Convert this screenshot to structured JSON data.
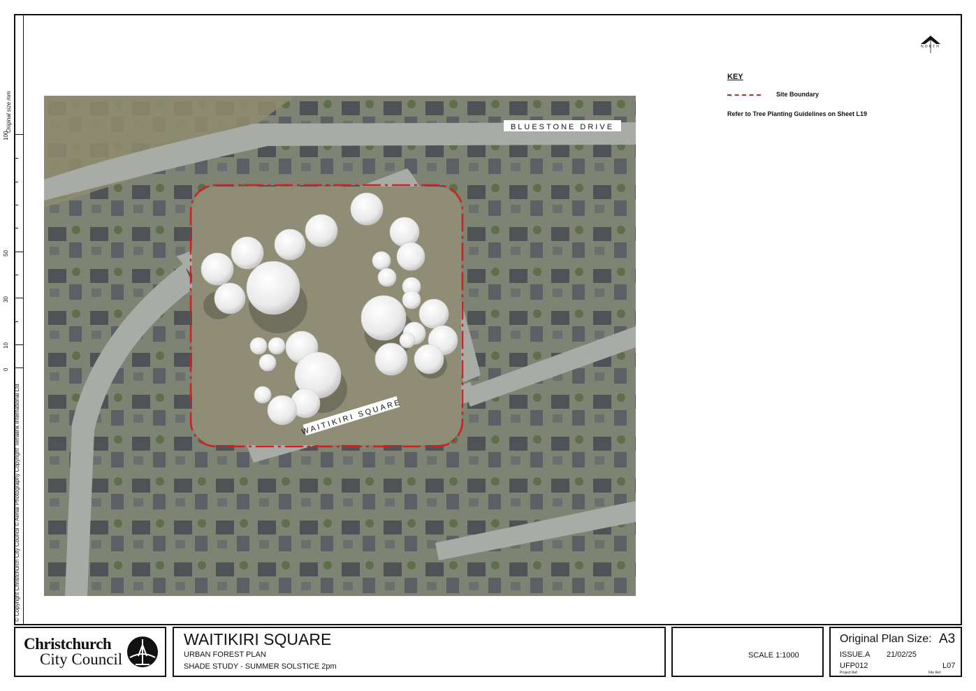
{
  "ruler": {
    "caption": "Original size mm",
    "ticks": [
      "100",
      "50",
      "30",
      "10",
      "0"
    ]
  },
  "copyright": "© Copyright Christchurch City Council   © Aerial Photography Copyright Terralink International Ltd",
  "north": {
    "label": "NORTH",
    "icon": "north-arrow-icon"
  },
  "key": {
    "title": "KEY",
    "items": [
      {
        "label": "Site Boundary",
        "style": "red-dashed-line",
        "color": "#d21f1f"
      }
    ],
    "note": "Refer to Tree Planting Guidelines on Sheet L19"
  },
  "map": {
    "type": "aerial-photo-plan",
    "street_labels": [
      "BLUESTONE DRIVE",
      "WAITIKIRI SQUARE"
    ],
    "boundary_color": "#d21f1f",
    "tree_canopy_color": "#f4f4f4"
  },
  "title_block": {
    "logo": {
      "line1": "Christchurch",
      "line2": "City Council",
      "icon": "ccc-cathedral-logo-icon"
    },
    "project": {
      "title": "WAITIKIRI SQUARE",
      "subtitle1": "URBAN FOREST PLAN",
      "subtitle2": "SHADE STUDY - SUMMER SOLSTICE 2pm"
    },
    "scale": "SCALE    1:1000",
    "plan_size_label": "Original Plan Size:",
    "plan_size_value": "A3",
    "issue": "ISSUE.A",
    "date": "21/02/25",
    "project_ref": "UFP012",
    "file_ref": "L07",
    "project_ref_caption": "Project Ref.",
    "file_ref_caption": "File Ref."
  }
}
